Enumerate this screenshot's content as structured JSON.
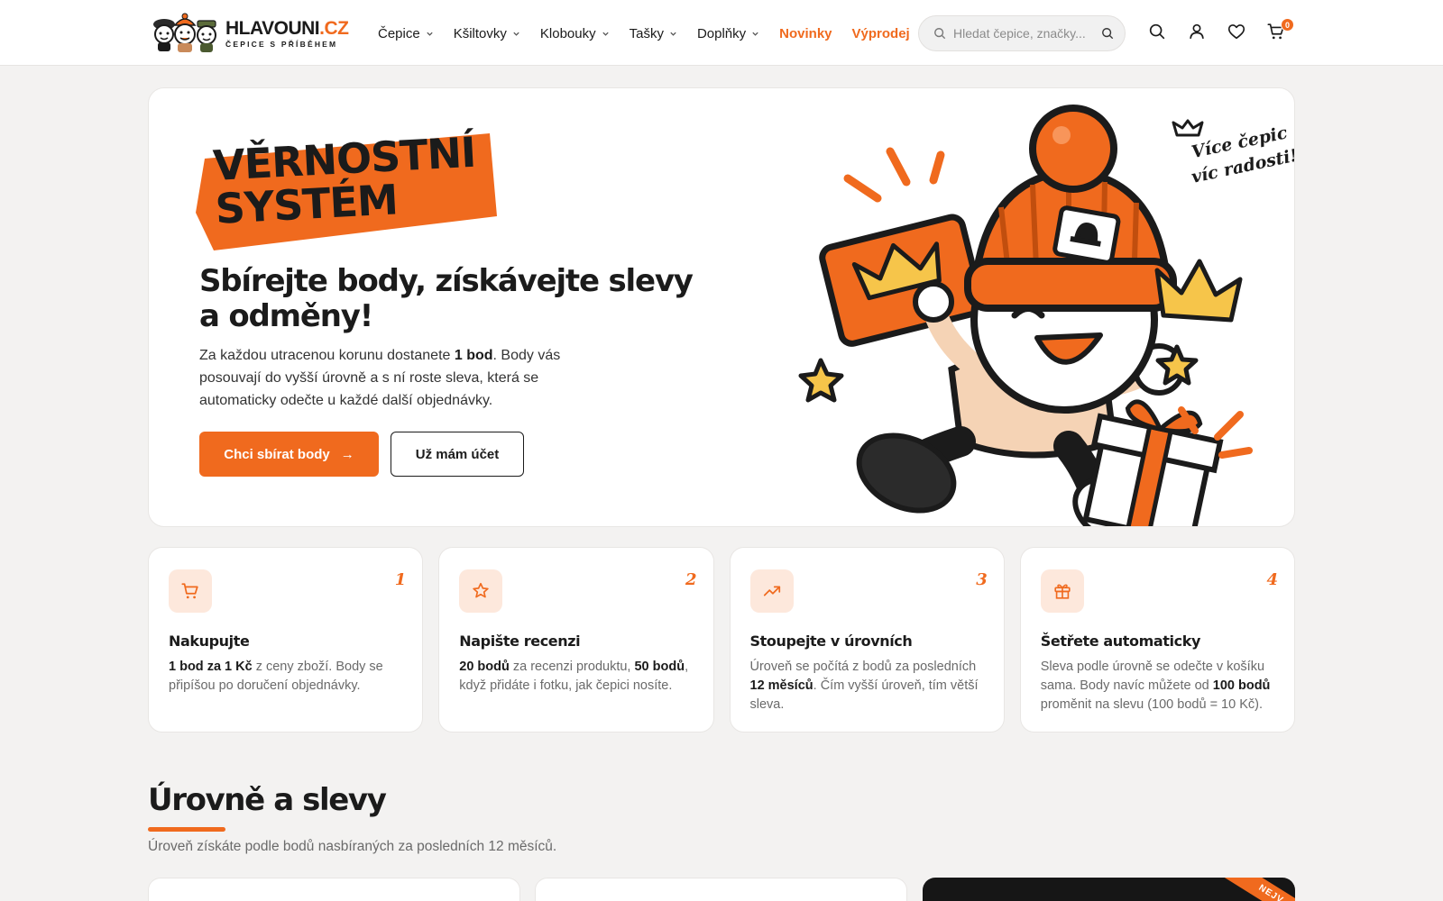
{
  "header": {
    "logo": {
      "name": "HLAVOUNI",
      "tld": ".CZ",
      "tagline": "ČEPICE S PŘÍBĚHEM"
    },
    "nav": [
      {
        "label": "Čepice",
        "dropdown": true
      },
      {
        "label": "Kšiltovky",
        "dropdown": true
      },
      {
        "label": "Klobouky",
        "dropdown": true
      },
      {
        "label": "Tašky",
        "dropdown": true
      },
      {
        "label": "Doplňky",
        "dropdown": true
      },
      {
        "label": "Novinky",
        "dropdown": false,
        "accent": true
      },
      {
        "label": "Výprodej",
        "dropdown": false,
        "accent": true
      }
    ],
    "search": {
      "placeholder": "Hledat čepice, značky..."
    },
    "icons": [
      "search-icon",
      "user-icon",
      "heart-icon",
      "cart-icon"
    ],
    "cart_count": "0"
  },
  "hero": {
    "badge": [
      "VĚRNOSTNÍ",
      "SYSTÉM"
    ],
    "title": "Sbírejte body, získávejte slevy a odměny!",
    "desc_pre": "Za každou utracenou korunu dostanete ",
    "desc_bold": "1 bod",
    "desc_post": ". Body vás posouvají do vyšší úrovně a s ní roste sleva, která se automaticky odečte u každé další objednávky.",
    "primary_cta": "Chci sbírat body",
    "secondary_cta": "Už mám účet",
    "handwritten": [
      "Více čepic",
      "víc radosti!"
    ]
  },
  "steps": [
    {
      "num": "1",
      "icon": "cart-icon",
      "title": "Nakupujte",
      "text": [
        {
          "b": "1 bod za 1 Kč"
        },
        {
          "t": " z ceny zboží. Body se připíšou po doručení objednávky."
        }
      ]
    },
    {
      "num": "2",
      "icon": "star-icon",
      "title": "Napište recenzi",
      "text": [
        {
          "b": "20 bodů"
        },
        {
          "t": " za recenzi produktu, "
        },
        {
          "b": "50 bodů"
        },
        {
          "t": ", když přidáte i fotku, jak čepici nosíte."
        }
      ]
    },
    {
      "num": "3",
      "icon": "trending-up-icon",
      "title": "Stoupejte v úrovních",
      "text": [
        {
          "t": "Úroveň se počítá z bodů za posledních "
        },
        {
          "b": "12 měsíců"
        },
        {
          "t": ". Čím vyšší úroveň, tím větší sleva."
        }
      ]
    },
    {
      "num": "4",
      "icon": "gift-icon",
      "title": "Šetřete automaticky",
      "text": [
        {
          "t": "Sleva podle úrovně se odečte v košíku sama. Body navíc můžete od "
        },
        {
          "b": "100 bodů"
        },
        {
          "t": " proměnit na slevu (100 bodů = 10 Kč)."
        }
      ]
    }
  ],
  "levels": {
    "title": "Úrovně a slevy",
    "subtitle": "Úroveň získáte podle bodů nasbíraných za posledních 12 měsíců.",
    "ribbon": "NEJV"
  },
  "colors": {
    "accent": "#f06a1e",
    "dark": "#1b1b1b",
    "bg": "#f3f2f1"
  }
}
